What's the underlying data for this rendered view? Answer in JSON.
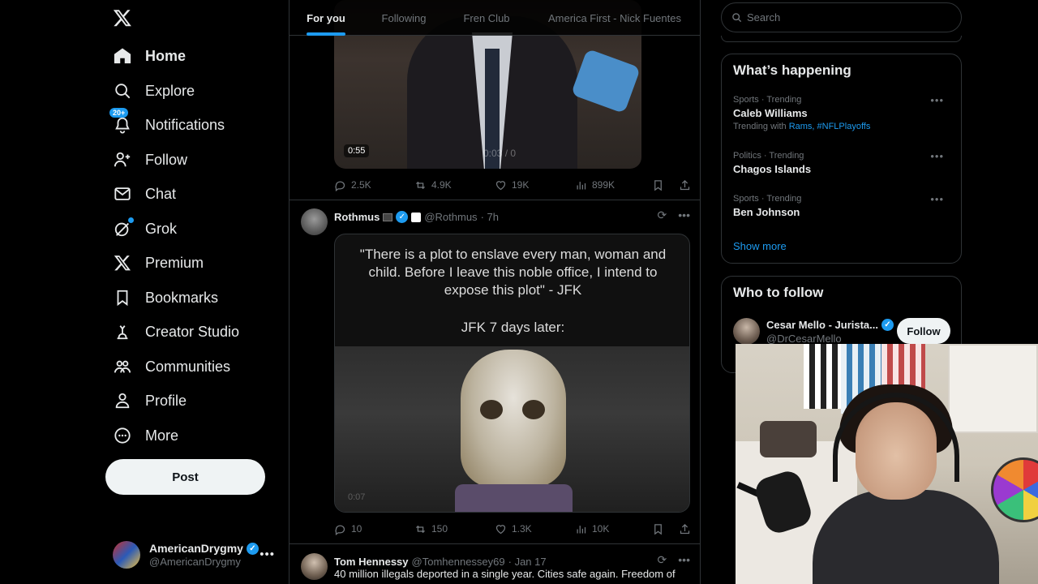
{
  "sidebar": {
    "logo": "𝕏",
    "nav": [
      {
        "label": "Home",
        "icon": "home-icon",
        "active": true
      },
      {
        "label": "Explore",
        "icon": "search-icon"
      },
      {
        "label": "Notifications",
        "icon": "bell-icon",
        "badge": "20+"
      },
      {
        "label": "Follow",
        "icon": "add-person-icon"
      },
      {
        "label": "Chat",
        "icon": "mail-icon"
      },
      {
        "label": "Grok",
        "icon": "grok-icon"
      },
      {
        "label": "Premium",
        "icon": "x-logo-icon"
      },
      {
        "label": "Bookmarks",
        "icon": "bookmark-icon"
      },
      {
        "label": "Creator Studio",
        "icon": "creator-studio-icon"
      },
      {
        "label": "Communities",
        "icon": "communities-icon"
      },
      {
        "label": "Profile",
        "icon": "person-icon"
      },
      {
        "label": "More",
        "icon": "more-circle-icon"
      }
    ],
    "post_label": "Post",
    "account": {
      "name": "AmericanDrygmy",
      "handle": "@AmericanDrygmy"
    }
  },
  "feed": {
    "tabs": [
      {
        "label": "For you",
        "active": true
      },
      {
        "label": "Following"
      },
      {
        "label": "Fren Club"
      },
      {
        "label": "America First - Nick Fuentes"
      }
    ],
    "tweet1": {
      "video_time": "0:55",
      "video_progress": "0:03 / 0",
      "replies": "2.5K",
      "reposts": "4.9K",
      "likes": "19K",
      "views": "899K"
    },
    "tweet2": {
      "name": "Rothmus",
      "handle": "@Rothmus",
      "time": "· 7h",
      "quote": "\"There is a plot to enslave every man, woman and child. Before I leave this noble office, I intend to expose this plot\" - JFK",
      "caption": "JFK 7 days later:",
      "video_time": "0:07",
      "replies": "10",
      "reposts": "150",
      "likes": "1.3K",
      "views": "10K"
    },
    "tweet3": {
      "name": "Tom Hennessy",
      "handle": "@Tomhennessey69",
      "time": "· Jan 17",
      "text": "40 million illegals deported in a single year. Cities safe again. Freedom of"
    }
  },
  "right": {
    "search_placeholder": "Search",
    "trending_title": "What’s happening",
    "trends": [
      {
        "category": "Sports · Trending",
        "name": "Caleb Williams",
        "with_prefix": "Trending with",
        "with_links": "Rams, #NFLPlayoffs"
      },
      {
        "category": "Politics · Trending",
        "name": "Chagos Islands"
      },
      {
        "category": "Sports · Trending",
        "name": "Ben Johnson"
      }
    ],
    "show_more": "Show more",
    "who_to_follow_title": "Who to follow",
    "suggestion": {
      "name": "Cesar Mello - Jurista...",
      "handle": "@DrCesarMello",
      "follow_label": "Follow"
    }
  },
  "colors": {
    "accent": "#1d9bf0",
    "background": "#000000",
    "border": "#2f3336",
    "muted_text": "#71767b"
  }
}
